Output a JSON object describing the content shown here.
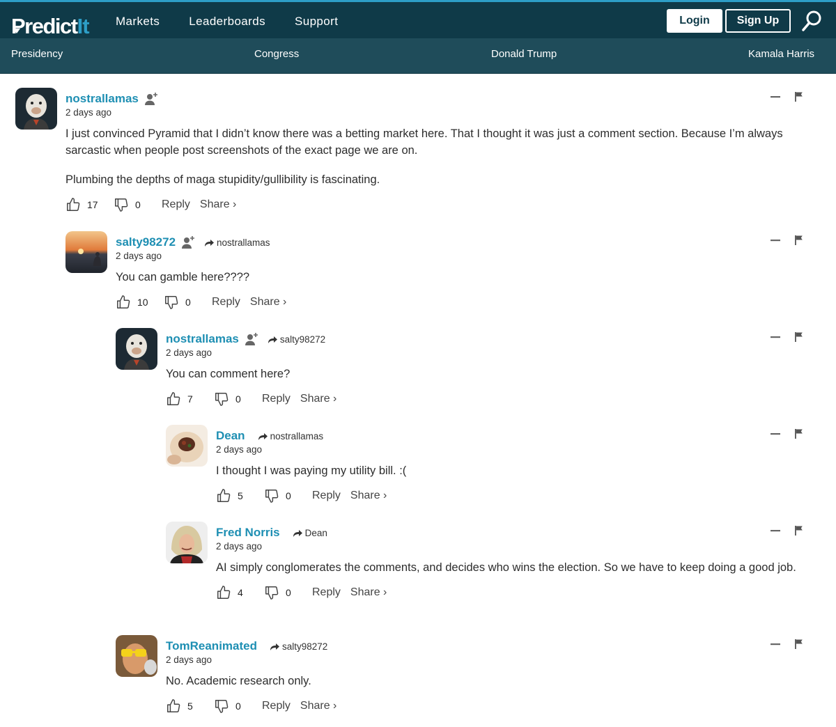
{
  "header": {
    "logo_main": "Predict",
    "logo_it": "It",
    "nav": [
      "Markets",
      "Leaderboards",
      "Support"
    ],
    "login_label": "Login",
    "signup_label": "Sign Up"
  },
  "subnav": [
    "Presidency",
    "Congress",
    "Donald Trump",
    "Kamala Harris"
  ],
  "action_labels": {
    "reply": "Reply",
    "share": "Share ›"
  },
  "comments": [
    {
      "user": "nostrallamas",
      "time": "2 days ago",
      "reply_to": "",
      "paragraphs": [
        "I just convinced Pyramid that I didn’t know there was a betting market here. That I thought it was just a comment section. Because I’m always sarcastic when people post screenshots of the exact page we are on.",
        "Plumbing the depths of maga stupidity/gullibility is fascinating."
      ],
      "likes": "17",
      "dislikes": "0"
    },
    {
      "user": "salty98272",
      "time": "2 days ago",
      "reply_to": "nostrallamas",
      "paragraphs": [
        "You can gamble here????"
      ],
      "likes": "10",
      "dislikes": "0"
    },
    {
      "user": "nostrallamas",
      "time": "2 days ago",
      "reply_to": "salty98272",
      "paragraphs": [
        "You can comment here?"
      ],
      "likes": "7",
      "dislikes": "0"
    },
    {
      "user": "Dean",
      "time": "2 days ago",
      "reply_to": "nostrallamas",
      "paragraphs": [
        "I thought I was paying my utility bill. :("
      ],
      "likes": "5",
      "dislikes": "0"
    },
    {
      "user": "Fred Norris",
      "time": "2 days ago",
      "reply_to": "Dean",
      "paragraphs": [
        "AI simply conglomerates the comments, and decides who wins the election. So we have to keep doing a good job."
      ],
      "likes": "4",
      "dislikes": "0"
    },
    {
      "user": "TomReanimated",
      "time": "2 days ago",
      "reply_to": "salty98272",
      "paragraphs": [
        "No. Academic research only."
      ],
      "likes": "5",
      "dislikes": "0"
    }
  ]
}
